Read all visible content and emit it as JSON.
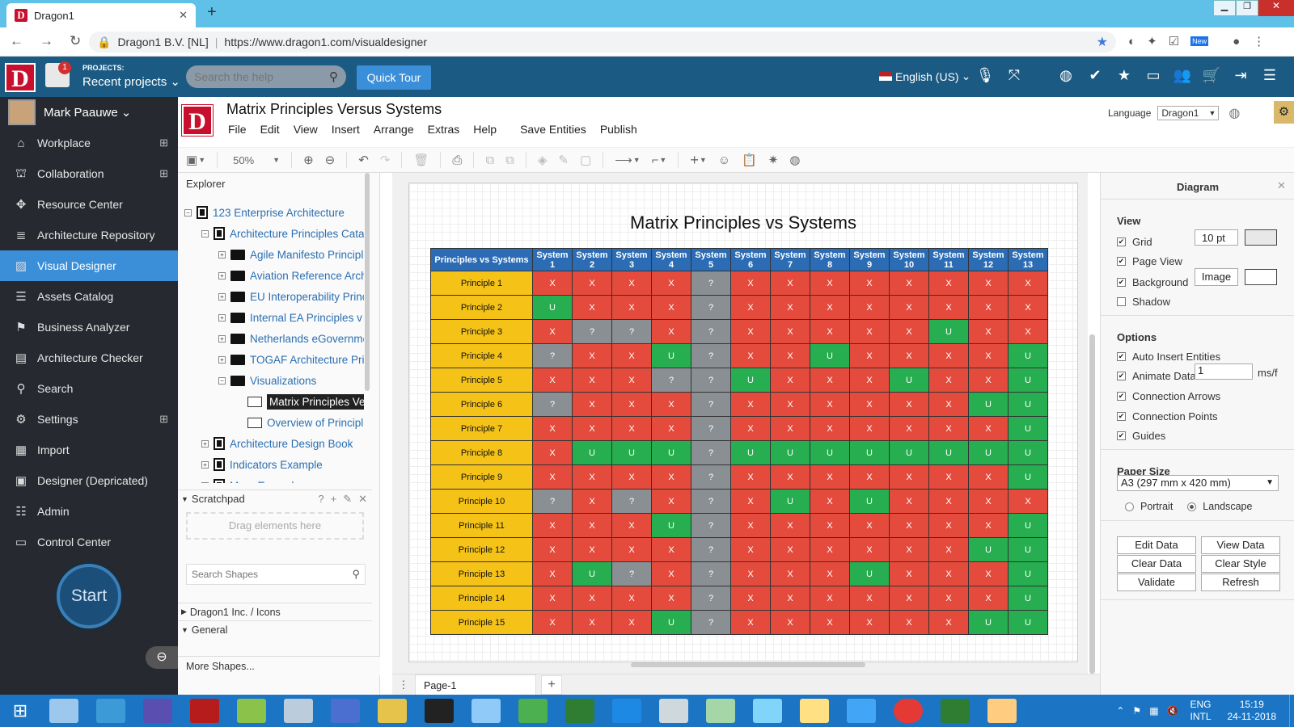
{
  "browser": {
    "tab_title": "Dragon1",
    "url_site": "Dragon1 B.V. [NL]",
    "url": "https://www.dragon1.com/visualdesigner",
    "new_badge": "New"
  },
  "header": {
    "logo": "D",
    "projects_label": "PROJECTS:",
    "recent_projects": "Recent projects",
    "notif_count": "1",
    "search_placeholder": "Search the help",
    "quick_tour": "Quick Tour",
    "language": "English (US)"
  },
  "user": {
    "name": "Mark Paauwe"
  },
  "sidebar": {
    "items": [
      {
        "label": "Workplace",
        "icon": "home-icon",
        "plus": true
      },
      {
        "label": "Collaboration",
        "icon": "sitemap-icon",
        "plus": true
      },
      {
        "label": "Resource Center",
        "icon": "puzzle-icon",
        "plus": false
      },
      {
        "label": "Architecture Repository",
        "icon": "database-icon",
        "plus": false
      },
      {
        "label": "Visual Designer",
        "icon": "image-icon",
        "plus": false,
        "active": true
      },
      {
        "label": "Assets Catalog",
        "icon": "list-icon",
        "plus": false
      },
      {
        "label": "Business Analyzer",
        "icon": "analyzer-icon",
        "plus": false
      },
      {
        "label": "Architecture Checker",
        "icon": "checker-icon",
        "plus": false
      },
      {
        "label": "Search",
        "icon": "search-icon",
        "plus": false
      },
      {
        "label": "Settings",
        "icon": "gear-icon",
        "plus": true
      },
      {
        "label": "Import",
        "icon": "table-icon",
        "plus": false
      },
      {
        "label": "Designer (Depricated)",
        "icon": "frame-icon",
        "plus": false
      },
      {
        "label": "Admin",
        "icon": "admin-icon",
        "plus": false
      },
      {
        "label": "Control Center",
        "icon": "monitor-icon",
        "plus": false
      }
    ],
    "start": "Start"
  },
  "document": {
    "title": "Matrix Principles Versus Systems",
    "menu": [
      "File",
      "Edit",
      "View",
      "Insert",
      "Arrange",
      "Extras",
      "Help",
      "Save Entities",
      "Publish"
    ],
    "language_label": "Language",
    "language_value": "Dragon1",
    "zoom": "50%"
  },
  "explorer": {
    "title": "Explorer",
    "tree": [
      {
        "label": "123 Enterprise Architecture",
        "level": 0,
        "kind": "doc",
        "exp": "−"
      },
      {
        "label": "Architecture Principles Cata",
        "level": 1,
        "kind": "book",
        "exp": "−"
      },
      {
        "label": "Agile Manifesto Principle",
        "level": 2,
        "kind": "folder",
        "exp": "+"
      },
      {
        "label": "Aviation Reference Arch",
        "level": 2,
        "kind": "folder",
        "exp": "+"
      },
      {
        "label": "EU Interoperability Princ",
        "level": 2,
        "kind": "folder",
        "exp": "+"
      },
      {
        "label": "Internal EA Principles v",
        "level": 2,
        "kind": "folder",
        "exp": "+"
      },
      {
        "label": "Netherlands eGovernme",
        "level": 2,
        "kind": "folder",
        "exp": "+"
      },
      {
        "label": "TOGAF Architecture Pri",
        "level": 2,
        "kind": "folder",
        "exp": "+"
      },
      {
        "label": "Visualizations",
        "level": 2,
        "kind": "folder",
        "exp": "−"
      },
      {
        "label": "Matrix Principles Ver",
        "level": 3,
        "kind": "image",
        "selected": true
      },
      {
        "label": "Overview of Principl",
        "level": 3,
        "kind": "image"
      },
      {
        "label": "Architecture Design Book",
        "level": 1,
        "kind": "book",
        "exp": "+"
      },
      {
        "label": "Indicators Example",
        "level": 1,
        "kind": "book",
        "exp": "+"
      },
      {
        "label": "More Examples",
        "level": 1,
        "kind": "book",
        "exp": "+"
      }
    ],
    "scratchpad": "Scratchpad",
    "scratch_help": "?",
    "drag_here": "Drag elements here",
    "search_shapes": "Search Shapes",
    "lib1": "Dragon1 Inc. / Icons",
    "lib2": "General",
    "more_shapes": "More Shapes..."
  },
  "pages": {
    "tab": "Page-1"
  },
  "matrix": {
    "title": "Matrix Principles vs Systems",
    "corner": "Principles vs Systems",
    "systems": [
      "System 1",
      "System 2",
      "System 3",
      "System 4",
      "System 5",
      "System 6",
      "System 7",
      "System 8",
      "System 9",
      "System 10",
      "System 11",
      "System 12",
      "System 13"
    ],
    "rows": [
      {
        "label": "Principle 1",
        "cells": [
          "X",
          "X",
          "X",
          "X",
          "?",
          "X",
          "X",
          "X",
          "X",
          "X",
          "X",
          "X",
          "X"
        ]
      },
      {
        "label": "Principle 2",
        "cells": [
          "U",
          "X",
          "X",
          "X",
          "?",
          "X",
          "X",
          "X",
          "X",
          "X",
          "X",
          "X",
          "X"
        ]
      },
      {
        "label": "Principle 3",
        "cells": [
          "X",
          "?",
          "?",
          "X",
          "?",
          "X",
          "X",
          "X",
          "X",
          "X",
          "U",
          "X",
          "X"
        ]
      },
      {
        "label": "Principle 4",
        "cells": [
          "?",
          "X",
          "X",
          "U",
          "?",
          "X",
          "X",
          "U",
          "X",
          "X",
          "X",
          "X",
          "U"
        ]
      },
      {
        "label": "Principle 5",
        "cells": [
          "X",
          "X",
          "X",
          "?",
          "?",
          "U",
          "X",
          "X",
          "X",
          "U",
          "X",
          "X",
          "U"
        ]
      },
      {
        "label": "Principle 6",
        "cells": [
          "?",
          "X",
          "X",
          "X",
          "?",
          "X",
          "X",
          "X",
          "X",
          "X",
          "X",
          "U",
          "U"
        ]
      },
      {
        "label": "Principle 7",
        "cells": [
          "X",
          "X",
          "X",
          "X",
          "?",
          "X",
          "X",
          "X",
          "X",
          "X",
          "X",
          "X",
          "U"
        ]
      },
      {
        "label": "Principle 8",
        "cells": [
          "X",
          "U",
          "U",
          "U",
          "?",
          "U",
          "U",
          "U",
          "U",
          "U",
          "U",
          "U",
          "U"
        ]
      },
      {
        "label": "Principle 9",
        "cells": [
          "X",
          "X",
          "X",
          "X",
          "?",
          "X",
          "X",
          "X",
          "X",
          "X",
          "X",
          "X",
          "U"
        ]
      },
      {
        "label": "Principle 10",
        "cells": [
          "?",
          "X",
          "?",
          "X",
          "?",
          "X",
          "U",
          "X",
          "U",
          "X",
          "X",
          "X",
          "X"
        ]
      },
      {
        "label": "Principle 11",
        "cells": [
          "X",
          "X",
          "X",
          "U",
          "?",
          "X",
          "X",
          "X",
          "X",
          "X",
          "X",
          "X",
          "U"
        ]
      },
      {
        "label": "Principle 12",
        "cells": [
          "X",
          "X",
          "X",
          "X",
          "?",
          "X",
          "X",
          "X",
          "X",
          "X",
          "X",
          "U",
          "U"
        ]
      },
      {
        "label": "Principle 13",
        "cells": [
          "X",
          "U",
          "?",
          "X",
          "?",
          "X",
          "X",
          "X",
          "U",
          "X",
          "X",
          "X",
          "U"
        ]
      },
      {
        "label": "Principle 14",
        "cells": [
          "X",
          "X",
          "X",
          "X",
          "?",
          "X",
          "X",
          "X",
          "X",
          "X",
          "X",
          "X",
          "U"
        ]
      },
      {
        "label": "Principle 15",
        "cells": [
          "X",
          "X",
          "X",
          "U",
          "?",
          "X",
          "X",
          "X",
          "X",
          "X",
          "X",
          "U",
          "U"
        ]
      }
    ]
  },
  "panel": {
    "title": "Diagram",
    "view": "View",
    "grid": "Grid",
    "grid_size": "10 pt",
    "page_view": "Page View",
    "background": "Background",
    "image_btn": "Image",
    "shadow": "Shadow",
    "options": "Options",
    "auto_insert": "Auto Insert Entities",
    "animate": "Animate Data",
    "animate_val": "1",
    "animate_unit": "ms/f",
    "conn_arrows": "Connection Arrows",
    "conn_points": "Connection Points",
    "guides": "Guides",
    "paper_size": "Paper Size",
    "paper_value": "A3 (297 mm x 420 mm)",
    "portrait": "Portrait",
    "landscape": "Landscape",
    "buttons": [
      "Edit Data",
      "View Data",
      "Clear Data",
      "Clear Style",
      "Validate",
      "Refresh"
    ]
  },
  "taskbar": {
    "lang": "ENG",
    "layout": "INTL",
    "time": "15:19",
    "date": "24-11-2018"
  },
  "colors": {
    "header": "#1b5a82",
    "sidebar": "#262a30",
    "active": "#3b8fd9",
    "x": "#e54b3c",
    "u": "#27ae50",
    "q": "#8a8f94",
    "principle": "#f5c218",
    "syshead": "#2b6cb5"
  }
}
